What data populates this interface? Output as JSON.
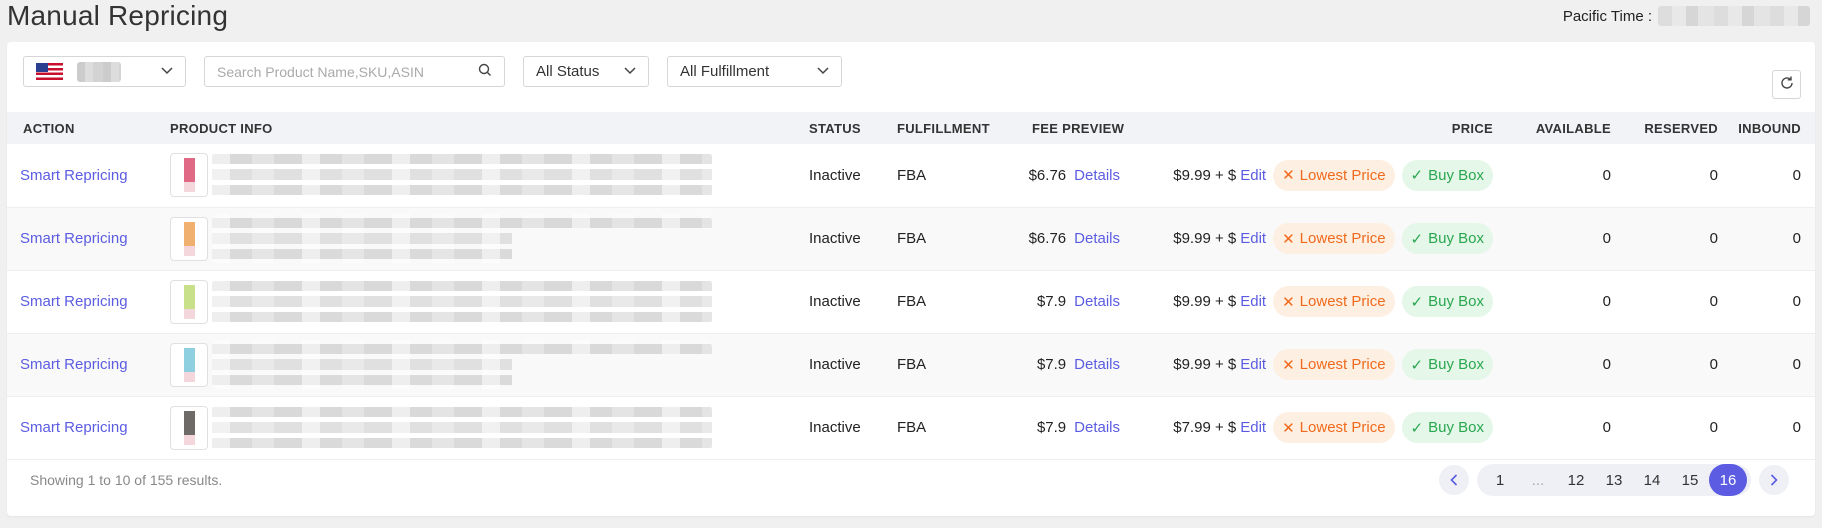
{
  "page_title": "Manual Repricing",
  "timezone_label": "Pacific Time :",
  "filters": {
    "search_placeholder": "Search Product Name,SKU,ASIN",
    "status_select": "All Status",
    "fulfillment_select": "All Fulfillment"
  },
  "table": {
    "headers": {
      "action": "ACTION",
      "product_info": "PRODUCT INFO",
      "status": "STATUS",
      "fulfillment": "FULFILLMENT",
      "fee_preview": "FEE PREVIEW",
      "price": "PRICE",
      "available": "AVAILABLE",
      "reserved": "RESERVED",
      "inbound": "INBOUND"
    },
    "rows": [
      {
        "action": "Smart Repricing",
        "status": "Inactive",
        "fulfillment": "FBA",
        "fee": "$6.76",
        "details": "Details",
        "price": "$9.99 + $",
        "edit": "Edit",
        "lowest": "Lowest Price",
        "buybox": "Buy Box",
        "available": "0",
        "reserved": "0",
        "inbound": "0",
        "thumb_color": "#e06a86"
      },
      {
        "action": "Smart Repricing",
        "status": "Inactive",
        "fulfillment": "FBA",
        "fee": "$6.76",
        "details": "Details",
        "price": "$9.99 + $",
        "edit": "Edit",
        "lowest": "Lowest Price",
        "buybox": "Buy Box",
        "available": "0",
        "reserved": "0",
        "inbound": "0",
        "thumb_color": "#f0b070"
      },
      {
        "action": "Smart Repricing",
        "status": "Inactive",
        "fulfillment": "FBA",
        "fee": "$7.9",
        "details": "Details",
        "price": "$9.99 + $",
        "edit": "Edit",
        "lowest": "Lowest Price",
        "buybox": "Buy Box",
        "available": "0",
        "reserved": "0",
        "inbound": "0",
        "thumb_color": "#c8e08a"
      },
      {
        "action": "Smart Repricing",
        "status": "Inactive",
        "fulfillment": "FBA",
        "fee": "$7.9",
        "details": "Details",
        "price": "$9.99 + $",
        "edit": "Edit",
        "lowest": "Lowest Price",
        "buybox": "Buy Box",
        "available": "0",
        "reserved": "0",
        "inbound": "0",
        "thumb_color": "#8fd0e0"
      },
      {
        "action": "Smart Repricing",
        "status": "Inactive",
        "fulfillment": "FBA",
        "fee": "$7.9",
        "details": "Details",
        "price": "$7.99 + $",
        "edit": "Edit",
        "lowest": "Lowest Price",
        "buybox": "Buy Box",
        "available": "0",
        "reserved": "0",
        "inbound": "0",
        "thumb_color": "#6e6a68"
      }
    ]
  },
  "footer": {
    "showing": "Showing 1 to 10 of 155 results.",
    "pages": [
      "1",
      "...",
      "12",
      "13",
      "14",
      "15",
      "16"
    ],
    "active_page": "16"
  },
  "colors": {
    "accent": "#5b5ce2",
    "lowest_price": "#f06a1d",
    "buy_box": "#2aa750"
  }
}
